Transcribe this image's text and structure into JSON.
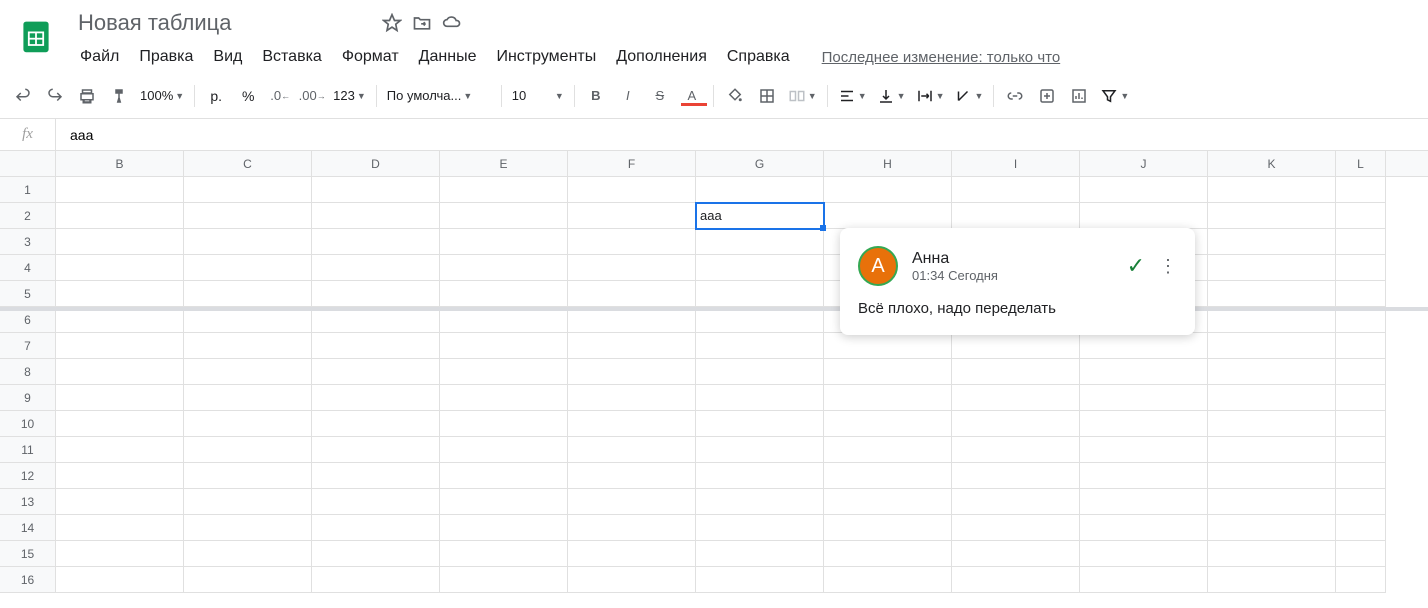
{
  "doc": {
    "title": "Новая таблица"
  },
  "menu": {
    "file": "Файл",
    "edit": "Правка",
    "view": "Вид",
    "insert": "Вставка",
    "format": "Формат",
    "data": "Данные",
    "tools": "Инструменты",
    "addons": "Дополнения",
    "help": "Справка",
    "lastedit": "Последнее изменение: только что"
  },
  "toolbar": {
    "zoom": "100%",
    "currency": "р.",
    "percent": "%",
    "dec_dec": ".0",
    "dec_inc": ".00",
    "numfmt": "123",
    "font": "По умолча...",
    "fontsize": "10"
  },
  "formula": {
    "fx": "fx",
    "value": "ааа"
  },
  "cols": [
    "B",
    "C",
    "D",
    "E",
    "F",
    "G",
    "H",
    "I",
    "J",
    "K",
    "L"
  ],
  "rows": [
    "1",
    "2",
    "3",
    "4",
    "5",
    "6",
    "7",
    "8",
    "9",
    "10",
    "11",
    "12",
    "13",
    "14",
    "15",
    "16"
  ],
  "cell_g2": "ааа",
  "comment": {
    "avatar_letter": "А",
    "author": "Анна",
    "time": "01:34 Сегодня",
    "body": "Всё плохо, надо переделать"
  }
}
